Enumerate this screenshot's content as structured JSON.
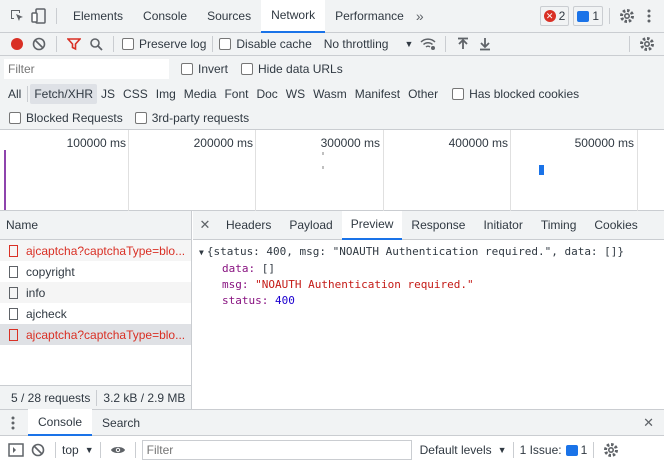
{
  "tabs": {
    "items": [
      "Elements",
      "Console",
      "Sources",
      "Network",
      "Performance"
    ],
    "more": "»",
    "errors": "2",
    "messages": "1"
  },
  "toolbar": {
    "preserve_log": "Preserve log",
    "disable_cache": "Disable cache",
    "throttling": "No throttling"
  },
  "filter": {
    "placeholder": "Filter",
    "invert": "Invert",
    "hide_data_urls": "Hide data URLs",
    "types": [
      "All",
      "Fetch/XHR",
      "JS",
      "CSS",
      "Img",
      "Media",
      "Font",
      "Doc",
      "WS",
      "Wasm",
      "Manifest",
      "Other"
    ],
    "active_type": "Fetch/XHR",
    "has_blocked_cookies": "Has blocked cookies",
    "blocked_requests": "Blocked Requests",
    "third_party": "3rd-party requests"
  },
  "timeline": {
    "ticks": [
      "100000 ms",
      "200000 ms",
      "300000 ms",
      "400000 ms",
      "500000 ms"
    ]
  },
  "requests": {
    "header": "Name",
    "items": [
      {
        "name": "ajcaptcha?captchaType=blo...",
        "error": true
      },
      {
        "name": "copyright",
        "error": false
      },
      {
        "name": "info",
        "error": false
      },
      {
        "name": "ajcheck",
        "error": false
      },
      {
        "name": "ajcaptcha?captchaType=blo...",
        "error": true
      }
    ],
    "status_count": "5 / 28 requests",
    "status_size": "3.2 kB / 2.9 MB"
  },
  "detail": {
    "tabs": [
      "Headers",
      "Payload",
      "Preview",
      "Response",
      "Initiator",
      "Timing",
      "Cookies"
    ],
    "active_tab": "Preview",
    "summary": "{status: 400, msg: \"NOAUTH Authentication required.\", data: []}",
    "data_key": "data:",
    "data_val": "[]",
    "msg_key": "msg:",
    "msg_val": "\"NOAUTH Authentication required.\"",
    "status_key": "status:",
    "status_val": "400"
  },
  "drawer": {
    "tabs": [
      "Console",
      "Search"
    ],
    "context": "top",
    "filter_placeholder": "Filter",
    "levels": "Default levels",
    "issues_label": "1 Issue:",
    "issues_count": "1"
  },
  "colors": {
    "accent": "#1a73e8",
    "error": "#d93025",
    "record": "#d93025"
  }
}
